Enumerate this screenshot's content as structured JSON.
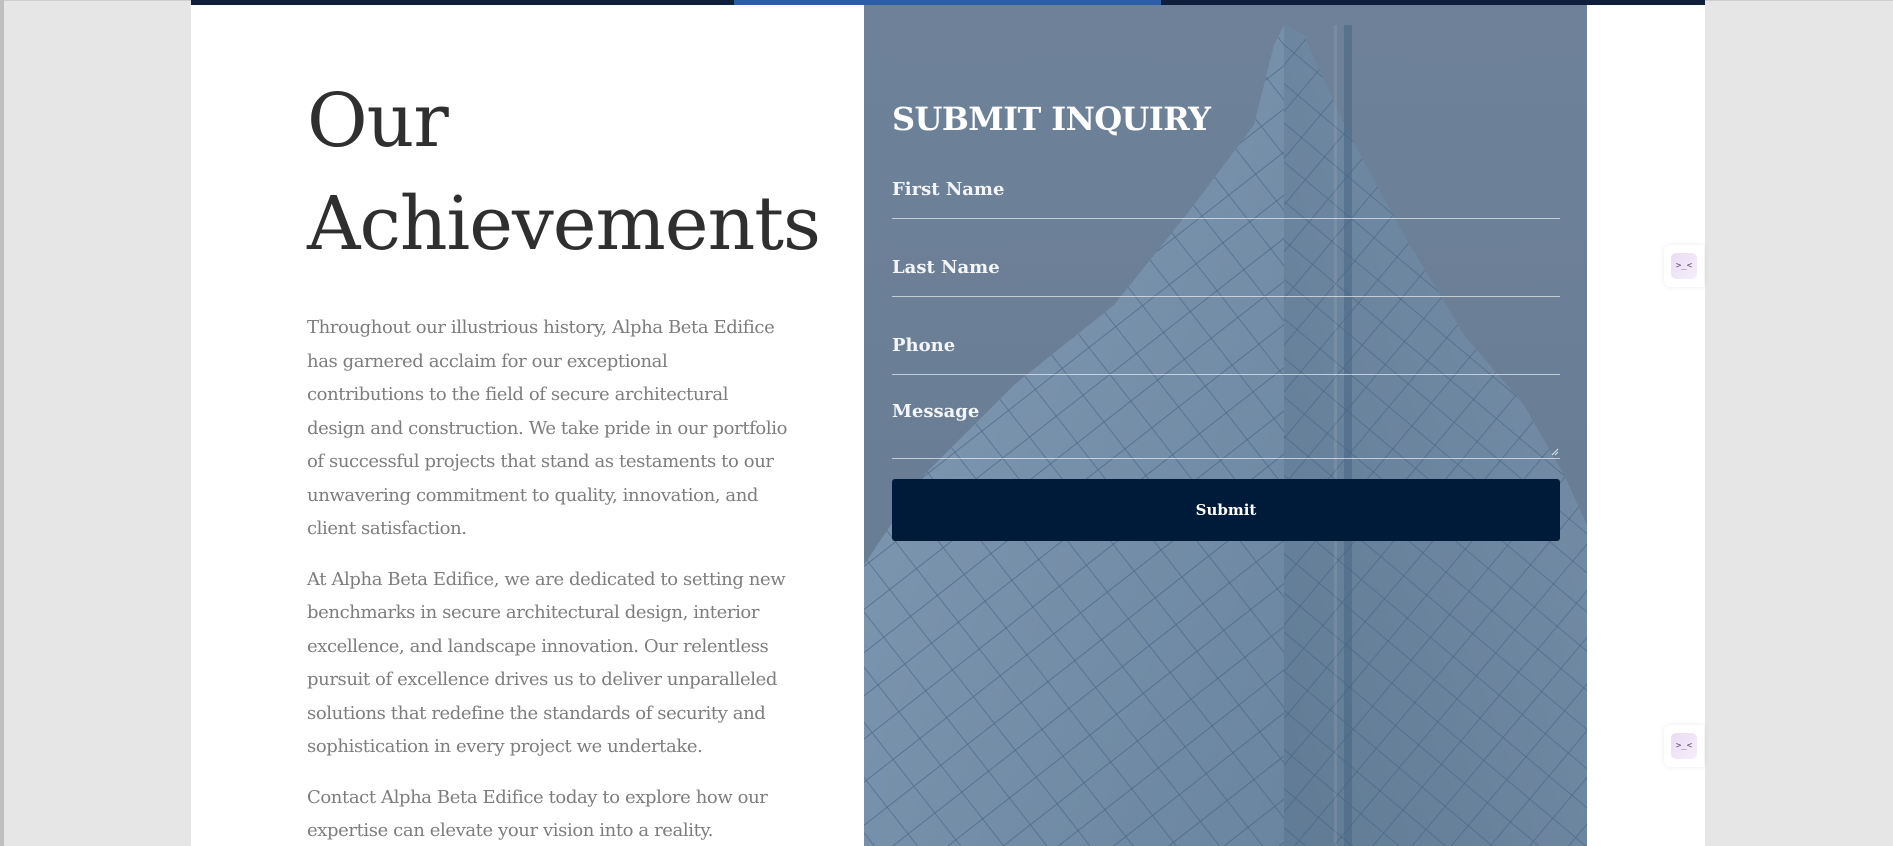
{
  "achievements": {
    "title_line1": "Our",
    "title_line2": "Achievements",
    "paragraphs": [
      "Throughout our illustrious history, Alpha Beta Edifice has garnered acclaim for our exceptional contributions to the field of secure architectural design and construction. We take pride in our portfolio of successful projects that stand as testaments to our unwavering commitment to quality, innovation, and client satisfaction.",
      "At Alpha Beta Edifice, we are dedicated to setting new benchmarks in secure architectural design, interior excellence, and landscape innovation. Our relentless pursuit of excellence drives us to deliver unparalleled solutions that redefine the standards of security and sophistication in every project we undertake.",
      "Contact Alpha Beta Edifice today to explore how our expertise can elevate your vision into a reality."
    ]
  },
  "inquiry_form": {
    "title": "SUBMIT INQUIRY",
    "first_name_placeholder": "First Name",
    "last_name_placeholder": "Last Name",
    "phone_placeholder": "Phone",
    "message_placeholder": "Message",
    "submit_label": "Submit"
  },
  "widgets": [
    {
      "icon": "terminal-face-icon",
      "glyph": ">_<"
    },
    {
      "icon": "terminal-face-icon",
      "glyph": ">_<"
    }
  ],
  "colors": {
    "top_bar": "#0f1e3a",
    "top_bar_accent": "#2b5da8",
    "submit_button": "#001a3a",
    "panel_overlay": "#6a7e95"
  }
}
